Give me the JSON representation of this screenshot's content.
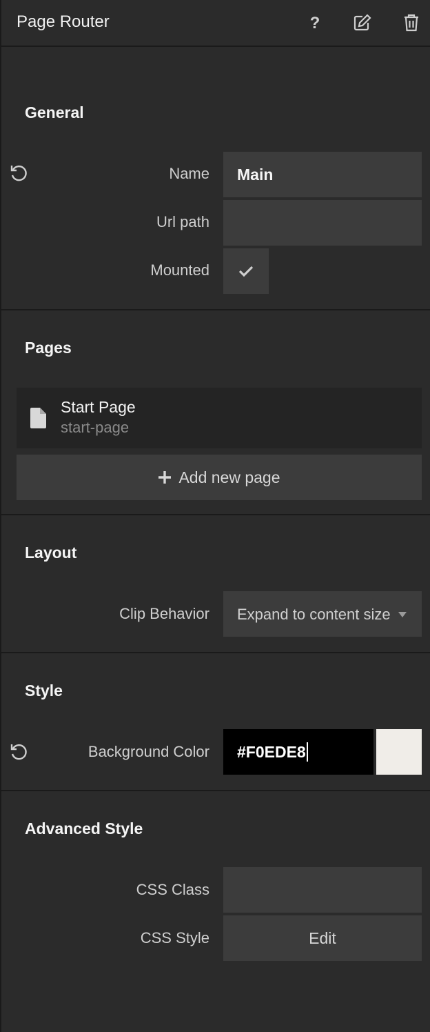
{
  "header": {
    "title": "Page Router",
    "icons": [
      "help-icon",
      "edit-icon",
      "trash-icon"
    ]
  },
  "general": {
    "title": "General",
    "name_label": "Name",
    "name_value": "Main",
    "url_label": "Url path",
    "url_value": "",
    "mounted_label": "Mounted",
    "mounted_checked": true
  },
  "pages": {
    "title": "Pages",
    "items": [
      {
        "name": "Start Page",
        "slug": "start-page",
        "icon": "file-icon"
      }
    ],
    "add_label": "Add new page"
  },
  "layout": {
    "title": "Layout",
    "clip_label": "Clip Behavior",
    "clip_value": "Expand to content size"
  },
  "style": {
    "title": "Style",
    "bg_label": "Background Color",
    "bg_value": "#F0EDE8",
    "swatch_color": "#F0EDE8"
  },
  "advanced": {
    "title": "Advanced Style",
    "class_label": "CSS Class",
    "class_value": "",
    "style_label": "CSS Style",
    "edit_label": "Edit"
  }
}
